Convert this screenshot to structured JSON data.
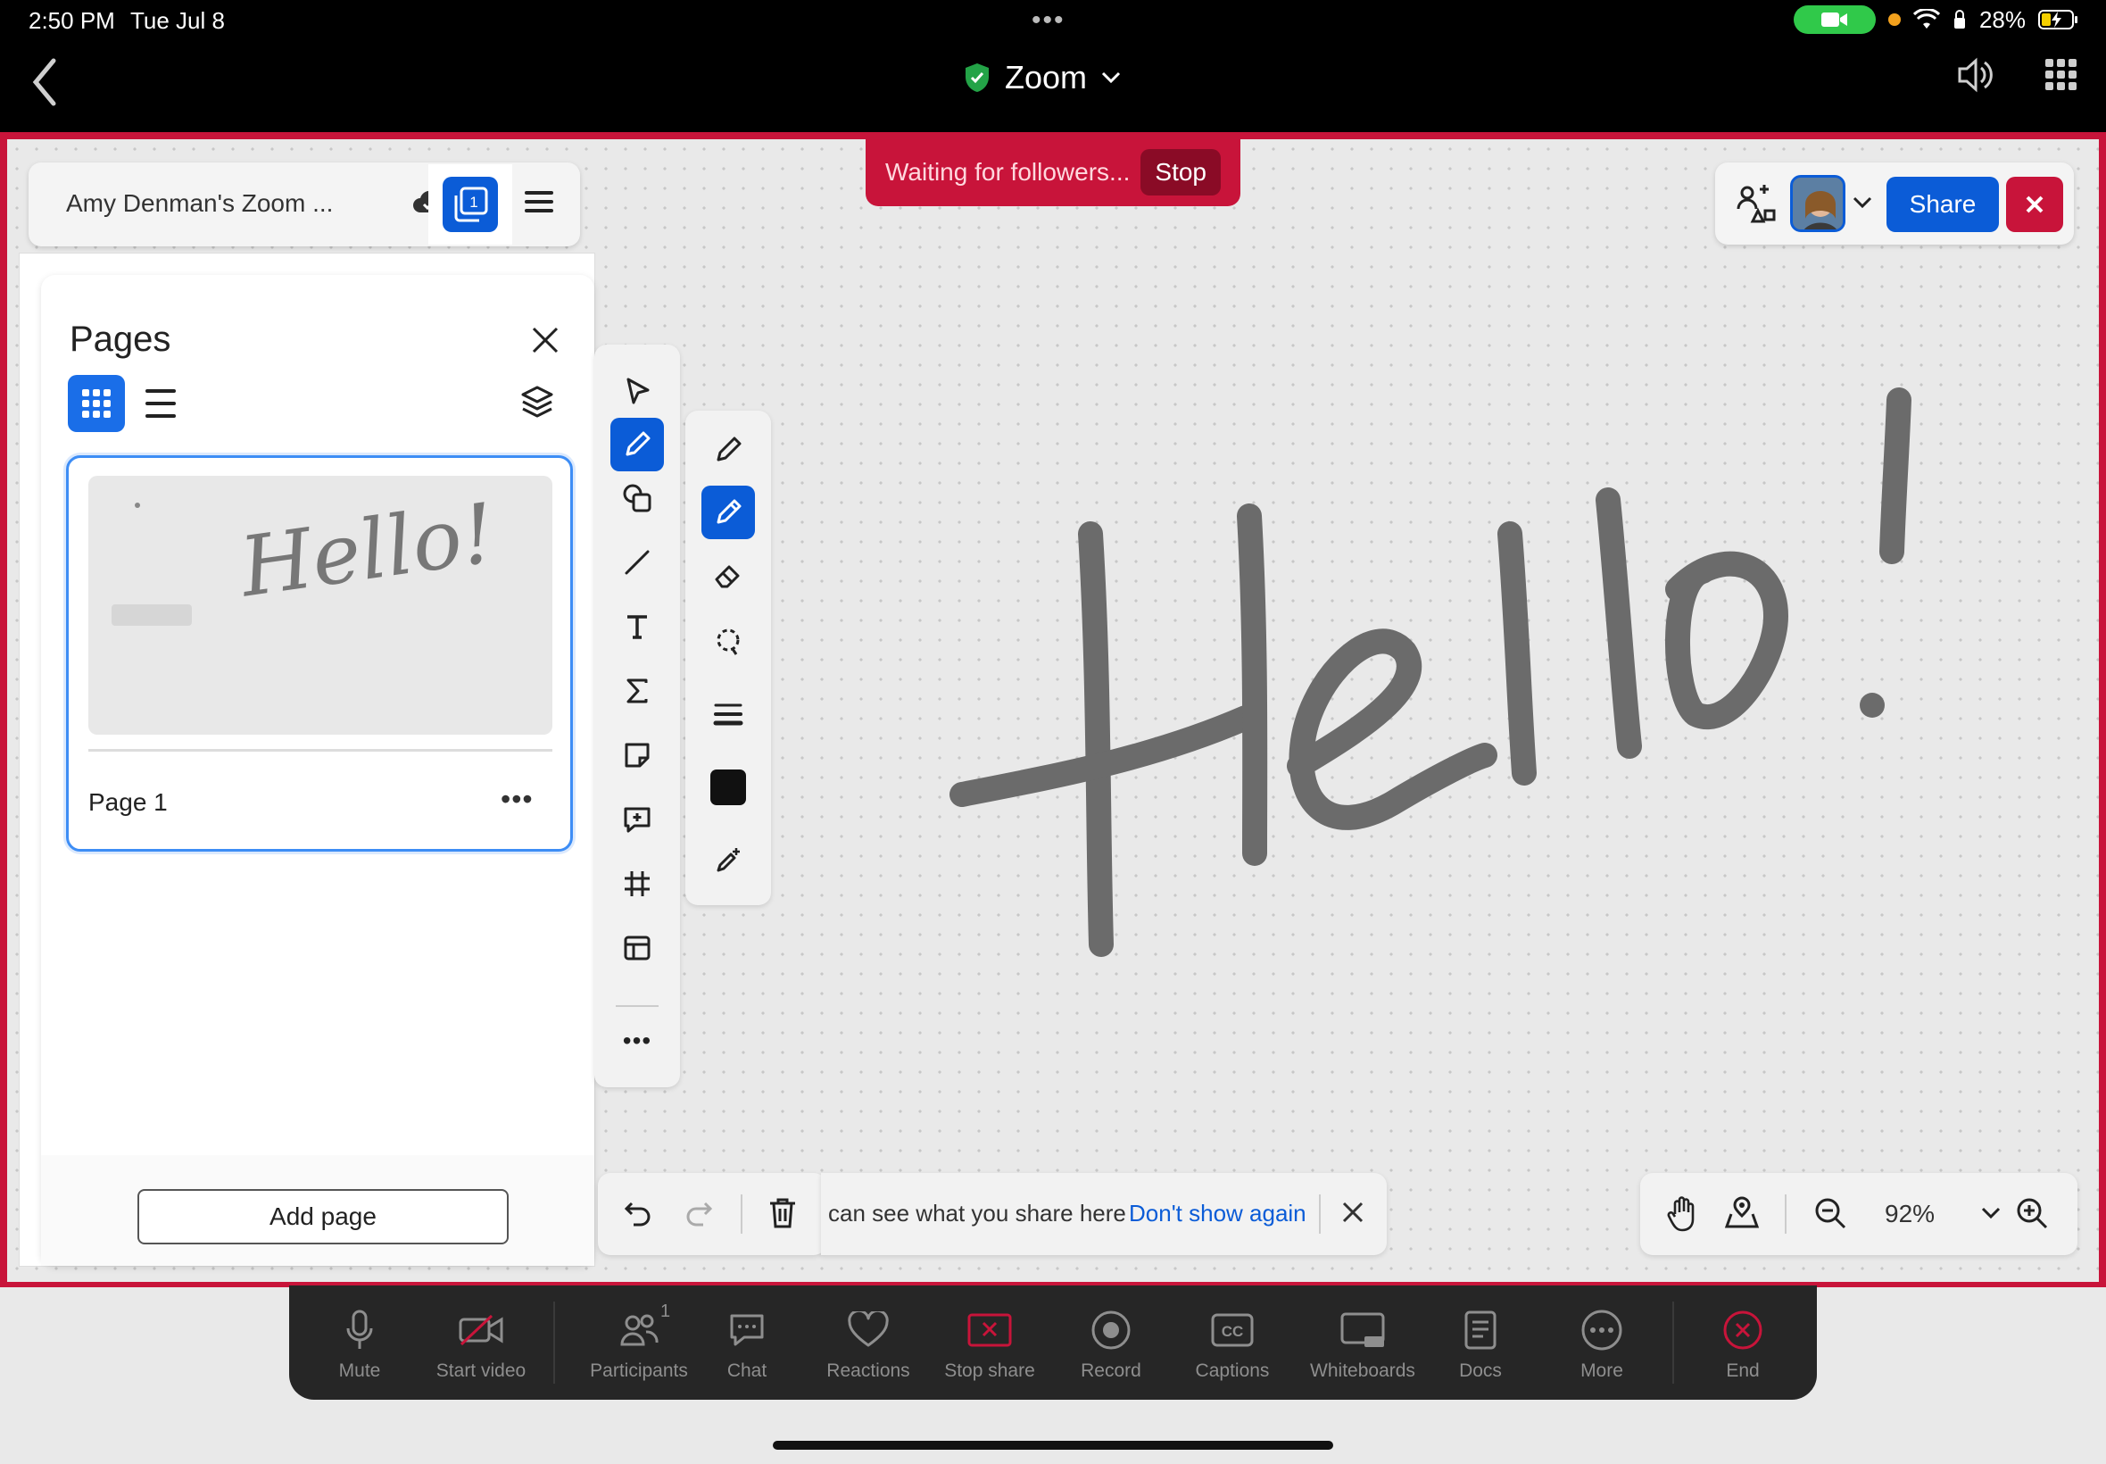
{
  "status": {
    "time": "2:50 PM",
    "date": "Tue Jul 8",
    "battery": "28%"
  },
  "nav": {
    "title": "Zoom"
  },
  "whiteboard": {
    "doc_name": "Amy Denman's Zoom ...",
    "page_count_badge": "1",
    "waiting_text": "Waiting for followers...",
    "stop_label": "Stop",
    "share_label": "Share"
  },
  "pages_panel": {
    "title": "Pages",
    "pages": [
      {
        "label": "Page 1"
      }
    ],
    "add_page_label": "Add page",
    "thumb_text": "Hello!"
  },
  "notice": {
    "text": "can see what you share here",
    "dismiss_link": "Don't show again"
  },
  "zoom": {
    "percent": "92%"
  },
  "meeting_toolbar": {
    "items": [
      {
        "label": "Mute",
        "icon": "microphone-icon"
      },
      {
        "label": "Start video",
        "icon": "video-off-icon"
      },
      {
        "label": "Participants",
        "icon": "participants-icon",
        "badge": "1"
      },
      {
        "label": "Chat",
        "icon": "chat-icon"
      },
      {
        "label": "Reactions",
        "icon": "heart-icon"
      },
      {
        "label": "Stop share",
        "icon": "stop-share-icon"
      },
      {
        "label": "Record",
        "icon": "record-icon"
      },
      {
        "label": "Captions",
        "icon": "cc-icon"
      },
      {
        "label": "Whiteboards",
        "icon": "whiteboard-icon"
      },
      {
        "label": "Docs",
        "icon": "docs-icon"
      },
      {
        "label": "More",
        "icon": "more-icon"
      },
      {
        "label": "End",
        "icon": "end-icon"
      }
    ]
  },
  "colors": {
    "accent": "#0b5cd7",
    "share_border": "#c8143a",
    "toolbar_bg": "#262626"
  }
}
